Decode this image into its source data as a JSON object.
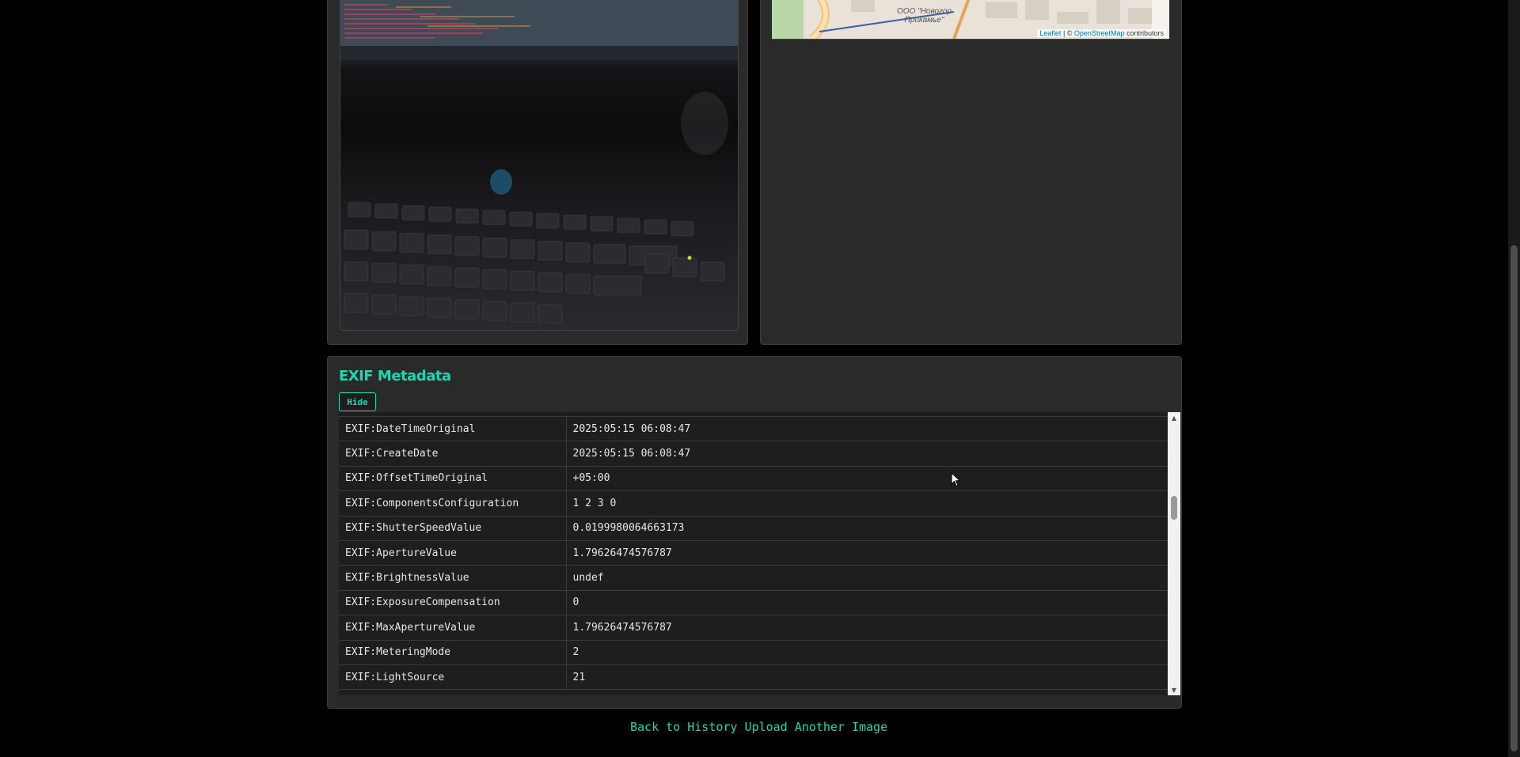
{
  "map": {
    "place_label_line1": "ООО \"Новогор",
    "place_label_line2": "Прикамье\"",
    "attribution_leaflet": "Leaflet",
    "attribution_sep": " | © ",
    "attribution_osm": "OpenStreetMap",
    "attribution_tail": " contributors"
  },
  "exif": {
    "title": "EXIF Metadata",
    "hide_label": "Hide",
    "rows": [
      {
        "key": "EXIF:DateTimeOriginal",
        "value": "2025:05:15 06:08:47"
      },
      {
        "key": "EXIF:CreateDate",
        "value": "2025:05:15 06:08:47"
      },
      {
        "key": "EXIF:OffsetTimeOriginal",
        "value": "+05:00"
      },
      {
        "key": "EXIF:ComponentsConfiguration",
        "value": "1 2 3 0"
      },
      {
        "key": "EXIF:ShutterSpeedValue",
        "value": "0.0199980064663173"
      },
      {
        "key": "EXIF:ApertureValue",
        "value": "1.79626474576787"
      },
      {
        "key": "EXIF:BrightnessValue",
        "value": "undef"
      },
      {
        "key": "EXIF:ExposureCompensation",
        "value": "0"
      },
      {
        "key": "EXIF:MaxApertureValue",
        "value": "1.79626474576787"
      },
      {
        "key": "EXIF:MeteringMode",
        "value": "2"
      },
      {
        "key": "EXIF:LightSource",
        "value": "21"
      }
    ]
  },
  "footer": {
    "back_label": "Back to History",
    "upload_label": "Upload Another Image"
  },
  "colors": {
    "accent": "#1fd6b0",
    "panel": "#2a2a2a",
    "background": "#000000"
  }
}
